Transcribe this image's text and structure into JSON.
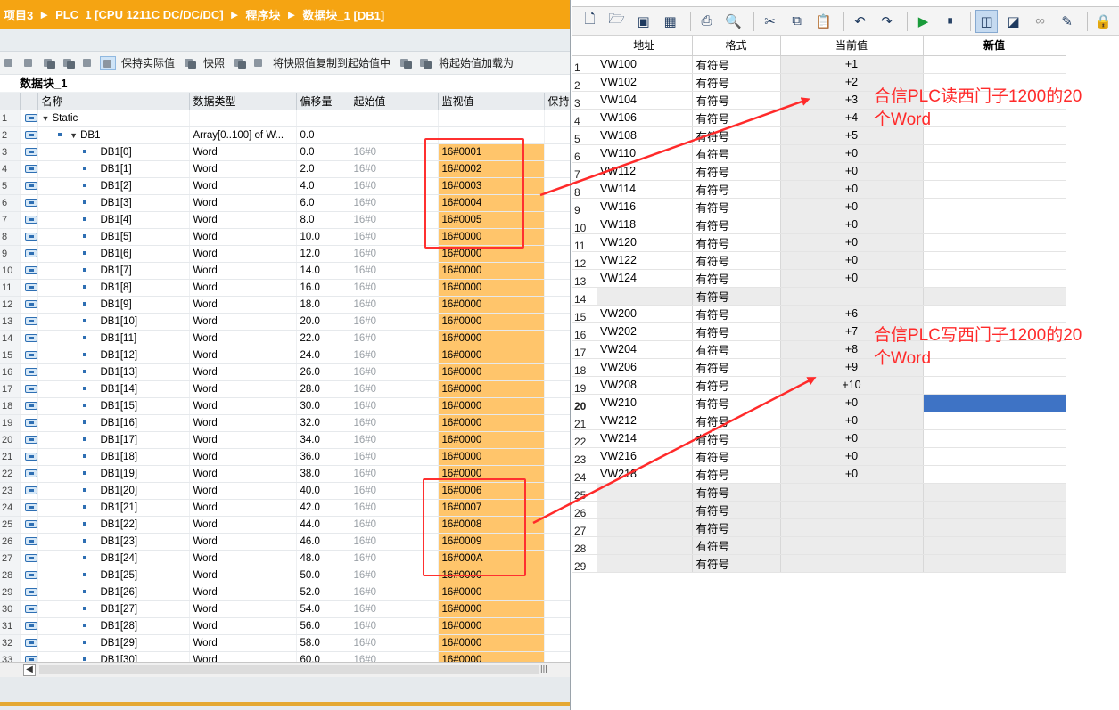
{
  "breadcrumb": [
    "项目3",
    "PLC_1 [CPU 1211C DC/DC/DC]",
    "程序块",
    "数据块_1 [DB1]"
  ],
  "left_toolbar": {
    "keep_actual": "保持实际值",
    "snapshot": "快照",
    "copy_snapshot": "将快照值复制到起始值中",
    "load_start": "将起始值加载为"
  },
  "db_title": "数据块_1",
  "columns": [
    "名称",
    "数据类型",
    "偏移量",
    "起始值",
    "监视值",
    "保持"
  ],
  "rows": [
    {
      "n": "1",
      "name": "Static",
      "type": "",
      "off": "",
      "start": "",
      "mon": ""
    },
    {
      "n": "2",
      "name": "DB1",
      "type": "Array[0..100] of W...",
      "off": "0.0",
      "start": "",
      "mon": ""
    },
    {
      "n": "3",
      "name": "DB1[0]",
      "type": "Word",
      "off": "0.0",
      "start": "16#0",
      "mon": "16#0001"
    },
    {
      "n": "4",
      "name": "DB1[1]",
      "type": "Word",
      "off": "2.0",
      "start": "16#0",
      "mon": "16#0002"
    },
    {
      "n": "5",
      "name": "DB1[2]",
      "type": "Word",
      "off": "4.0",
      "start": "16#0",
      "mon": "16#0003"
    },
    {
      "n": "6",
      "name": "DB1[3]",
      "type": "Word",
      "off": "6.0",
      "start": "16#0",
      "mon": "16#0004"
    },
    {
      "n": "7",
      "name": "DB1[4]",
      "type": "Word",
      "off": "8.0",
      "start": "16#0",
      "mon": "16#0005"
    },
    {
      "n": "8",
      "name": "DB1[5]",
      "type": "Word",
      "off": "10.0",
      "start": "16#0",
      "mon": "16#0000"
    },
    {
      "n": "9",
      "name": "DB1[6]",
      "type": "Word",
      "off": "12.0",
      "start": "16#0",
      "mon": "16#0000"
    },
    {
      "n": "10",
      "name": "DB1[7]",
      "type": "Word",
      "off": "14.0",
      "start": "16#0",
      "mon": "16#0000"
    },
    {
      "n": "11",
      "name": "DB1[8]",
      "type": "Word",
      "off": "16.0",
      "start": "16#0",
      "mon": "16#0000"
    },
    {
      "n": "12",
      "name": "DB1[9]",
      "type": "Word",
      "off": "18.0",
      "start": "16#0",
      "mon": "16#0000"
    },
    {
      "n": "13",
      "name": "DB1[10]",
      "type": "Word",
      "off": "20.0",
      "start": "16#0",
      "mon": "16#0000"
    },
    {
      "n": "14",
      "name": "DB1[11]",
      "type": "Word",
      "off": "22.0",
      "start": "16#0",
      "mon": "16#0000"
    },
    {
      "n": "15",
      "name": "DB1[12]",
      "type": "Word",
      "off": "24.0",
      "start": "16#0",
      "mon": "16#0000"
    },
    {
      "n": "16",
      "name": "DB1[13]",
      "type": "Word",
      "off": "26.0",
      "start": "16#0",
      "mon": "16#0000"
    },
    {
      "n": "17",
      "name": "DB1[14]",
      "type": "Word",
      "off": "28.0",
      "start": "16#0",
      "mon": "16#0000"
    },
    {
      "n": "18",
      "name": "DB1[15]",
      "type": "Word",
      "off": "30.0",
      "start": "16#0",
      "mon": "16#0000"
    },
    {
      "n": "19",
      "name": "DB1[16]",
      "type": "Word",
      "off": "32.0",
      "start": "16#0",
      "mon": "16#0000"
    },
    {
      "n": "20",
      "name": "DB1[17]",
      "type": "Word",
      "off": "34.0",
      "start": "16#0",
      "mon": "16#0000"
    },
    {
      "n": "21",
      "name": "DB1[18]",
      "type": "Word",
      "off": "36.0",
      "start": "16#0",
      "mon": "16#0000"
    },
    {
      "n": "22",
      "name": "DB1[19]",
      "type": "Word",
      "off": "38.0",
      "start": "16#0",
      "mon": "16#0000"
    },
    {
      "n": "23",
      "name": "DB1[20]",
      "type": "Word",
      "off": "40.0",
      "start": "16#0",
      "mon": "16#0006"
    },
    {
      "n": "24",
      "name": "DB1[21]",
      "type": "Word",
      "off": "42.0",
      "start": "16#0",
      "mon": "16#0007"
    },
    {
      "n": "25",
      "name": "DB1[22]",
      "type": "Word",
      "off": "44.0",
      "start": "16#0",
      "mon": "16#0008"
    },
    {
      "n": "26",
      "name": "DB1[23]",
      "type": "Word",
      "off": "46.0",
      "start": "16#0",
      "mon": "16#0009"
    },
    {
      "n": "27",
      "name": "DB1[24]",
      "type": "Word",
      "off": "48.0",
      "start": "16#0",
      "mon": "16#000A"
    },
    {
      "n": "28",
      "name": "DB1[25]",
      "type": "Word",
      "off": "50.0",
      "start": "16#0",
      "mon": "16#0000"
    },
    {
      "n": "29",
      "name": "DB1[26]",
      "type": "Word",
      "off": "52.0",
      "start": "16#0",
      "mon": "16#0000"
    },
    {
      "n": "30",
      "name": "DB1[27]",
      "type": "Word",
      "off": "54.0",
      "start": "16#0",
      "mon": "16#0000"
    },
    {
      "n": "31",
      "name": "DB1[28]",
      "type": "Word",
      "off": "56.0",
      "start": "16#0",
      "mon": "16#0000"
    },
    {
      "n": "32",
      "name": "DB1[29]",
      "type": "Word",
      "off": "58.0",
      "start": "16#0",
      "mon": "16#0000"
    },
    {
      "n": "33",
      "name": "DB1[30]",
      "type": "Word",
      "off": "60.0",
      "start": "16#0",
      "mon": "16#0000"
    }
  ],
  "right_columns": [
    "地址",
    "格式",
    "当前值",
    "新值"
  ],
  "right_rows": [
    {
      "n": "1",
      "addr": "VW100",
      "fmt": "有符号",
      "cur": "+1"
    },
    {
      "n": "2",
      "addr": "VW102",
      "fmt": "有符号",
      "cur": "+2"
    },
    {
      "n": "3",
      "addr": "VW104",
      "fmt": "有符号",
      "cur": "+3"
    },
    {
      "n": "4",
      "addr": "VW106",
      "fmt": "有符号",
      "cur": "+4"
    },
    {
      "n": "5",
      "addr": "VW108",
      "fmt": "有符号",
      "cur": "+5"
    },
    {
      "n": "6",
      "addr": "VW110",
      "fmt": "有符号",
      "cur": "+0"
    },
    {
      "n": "7",
      "addr": "VW112",
      "fmt": "有符号",
      "cur": "+0"
    },
    {
      "n": "8",
      "addr": "VW114",
      "fmt": "有符号",
      "cur": "+0"
    },
    {
      "n": "9",
      "addr": "VW116",
      "fmt": "有符号",
      "cur": "+0"
    },
    {
      "n": "10",
      "addr": "VW118",
      "fmt": "有符号",
      "cur": "+0"
    },
    {
      "n": "11",
      "addr": "VW120",
      "fmt": "有符号",
      "cur": "+0"
    },
    {
      "n": "12",
      "addr": "VW122",
      "fmt": "有符号",
      "cur": "+0"
    },
    {
      "n": "13",
      "addr": "VW124",
      "fmt": "有符号",
      "cur": "+0"
    },
    {
      "n": "14",
      "addr": "",
      "fmt": "有符号",
      "cur": ""
    },
    {
      "n": "15",
      "addr": "VW200",
      "fmt": "有符号",
      "cur": "+6"
    },
    {
      "n": "16",
      "addr": "VW202",
      "fmt": "有符号",
      "cur": "+7"
    },
    {
      "n": "17",
      "addr": "VW204",
      "fmt": "有符号",
      "cur": "+8"
    },
    {
      "n": "18",
      "addr": "VW206",
      "fmt": "有符号",
      "cur": "+9"
    },
    {
      "n": "19",
      "addr": "VW208",
      "fmt": "有符号",
      "cur": "+10"
    },
    {
      "n": "20",
      "addr": "VW210",
      "fmt": "有符号",
      "cur": "+0"
    },
    {
      "n": "21",
      "addr": "VW212",
      "fmt": "有符号",
      "cur": "+0"
    },
    {
      "n": "22",
      "addr": "VW214",
      "fmt": "有符号",
      "cur": "+0"
    },
    {
      "n": "23",
      "addr": "VW216",
      "fmt": "有符号",
      "cur": "+0"
    },
    {
      "n": "24",
      "addr": "VW218",
      "fmt": "有符号",
      "cur": "+0"
    },
    {
      "n": "25",
      "addr": "",
      "fmt": "有符号",
      "cur": ""
    },
    {
      "n": "26",
      "addr": "",
      "fmt": "有符号",
      "cur": ""
    },
    {
      "n": "27",
      "addr": "",
      "fmt": "有符号",
      "cur": ""
    },
    {
      "n": "28",
      "addr": "",
      "fmt": "有符号",
      "cur": ""
    },
    {
      "n": "29",
      "addr": "",
      "fmt": "有符号",
      "cur": ""
    }
  ],
  "annotations": {
    "read": [
      "合信PLC读西门子1200的20",
      "个Word"
    ],
    "write": [
      "合信PLC写西门子1200的20",
      "个Word"
    ]
  },
  "colors": {
    "breadcrumb_bg": "#f5a412",
    "monitor_cell": "#ffc56b",
    "annotation": "#ff2a2a",
    "selected_cell": "#3e73c5"
  }
}
